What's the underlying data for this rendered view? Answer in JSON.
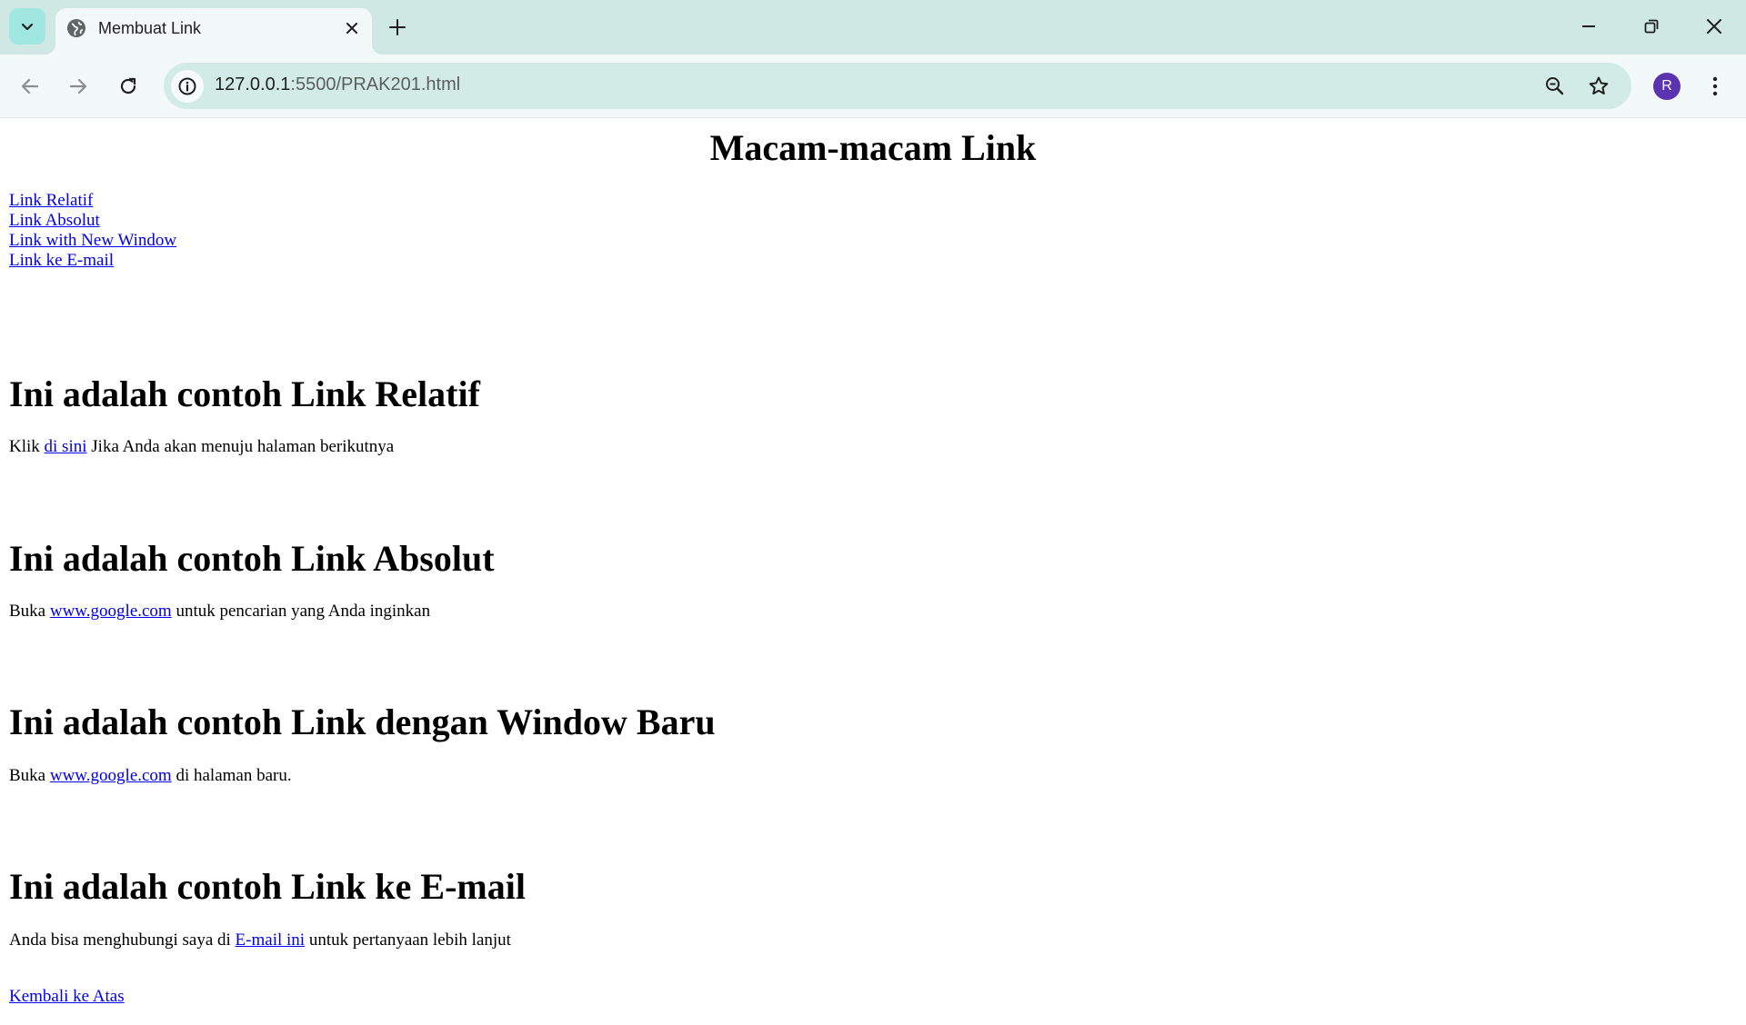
{
  "browser": {
    "tab": {
      "title": "Membuat Link"
    },
    "address_bar": {
      "url_host": "127.0.0.1",
      "url_rest": ":5500/PRAK201.html"
    },
    "profile_initial": "R",
    "icons": [
      "tab-search-icon",
      "globe-icon",
      "close-icon",
      "plus-icon",
      "minimize-icon",
      "restore-icon",
      "close-window-icon",
      "back-arrow-icon",
      "forward-arrow-icon",
      "reload-icon",
      "info-icon",
      "zoom-icon",
      "star-icon",
      "kebab-menu-icon"
    ]
  },
  "page": {
    "title": "Macam-macam Link",
    "nav_links": [
      "Link Relatif",
      "Link Absolut",
      "Link with New Window",
      "Link ke E-mail"
    ],
    "sections": [
      {
        "heading": "Ini adalah contoh Link Relatif",
        "before": "Klik ",
        "link": "di sini",
        "after": " Jika Anda akan menuju halaman berikutnya"
      },
      {
        "heading": "Ini adalah contoh Link Absolut",
        "before": "Buka ",
        "link": "www.google.com",
        "after": " untuk pencarian yang Anda inginkan"
      },
      {
        "heading": "Ini adalah contoh Link dengan Window Baru",
        "before": "Buka ",
        "link": "www.google.com",
        "after": " di halaman baru."
      },
      {
        "heading": "Ini adalah contoh Link ke E-mail",
        "before": "Anda bisa menghubungi saya di ",
        "link": "E-mail ini",
        "after": " untuk pertanyaan lebih lanjut"
      }
    ],
    "back_to_top": "Kembali ke Atas"
  }
}
